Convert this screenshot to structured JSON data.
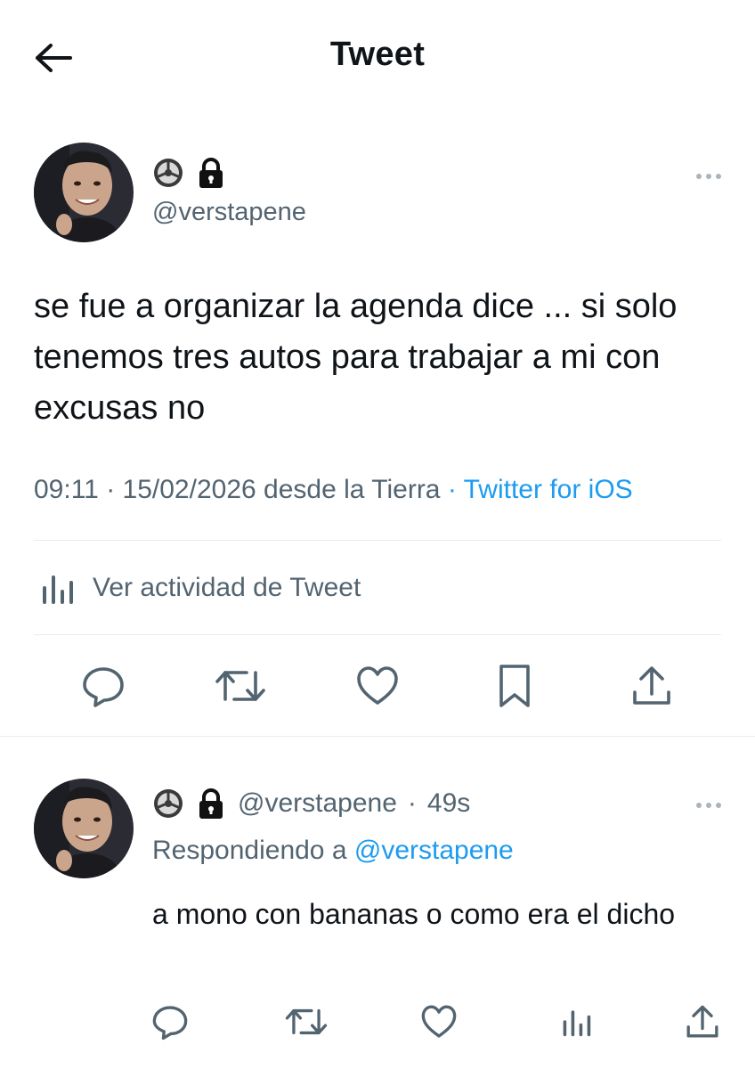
{
  "header": {
    "title": "Tweet",
    "back_icon": "arrow-left-icon"
  },
  "main_tweet": {
    "author_badges": [
      "steering-wheel-icon",
      "lock-icon"
    ],
    "handle": "@verstapene",
    "text": "se fue a organizar la agenda dice ... si solo tenemos tres autos para trabajar a mi con excusas no",
    "time": "09:11",
    "date": "15/02/2026",
    "location": "desde la Tierra",
    "separator": "·",
    "source": "Twitter for iOS",
    "activity_label": "Ver actividad de Tweet",
    "actions": [
      "reply-icon",
      "retweet-icon",
      "like-icon",
      "bookmark-icon",
      "share-icon"
    ]
  },
  "reply_tweet": {
    "author_badges": [
      "steering-wheel-icon",
      "lock-icon"
    ],
    "handle": "@verstapene",
    "separator": "·",
    "age": "49s",
    "replying_prefix": "Respondiendo a",
    "replying_to": "@verstapene",
    "text": "a mono con bananas o como era el dicho",
    "actions": [
      "reply-icon",
      "retweet-icon",
      "like-icon",
      "analytics-icon",
      "share-icon"
    ]
  },
  "colors": {
    "text": "#0f1419",
    "secondary": "#536471",
    "accent": "#1d9bf0",
    "divider": "#e6ecf0"
  }
}
